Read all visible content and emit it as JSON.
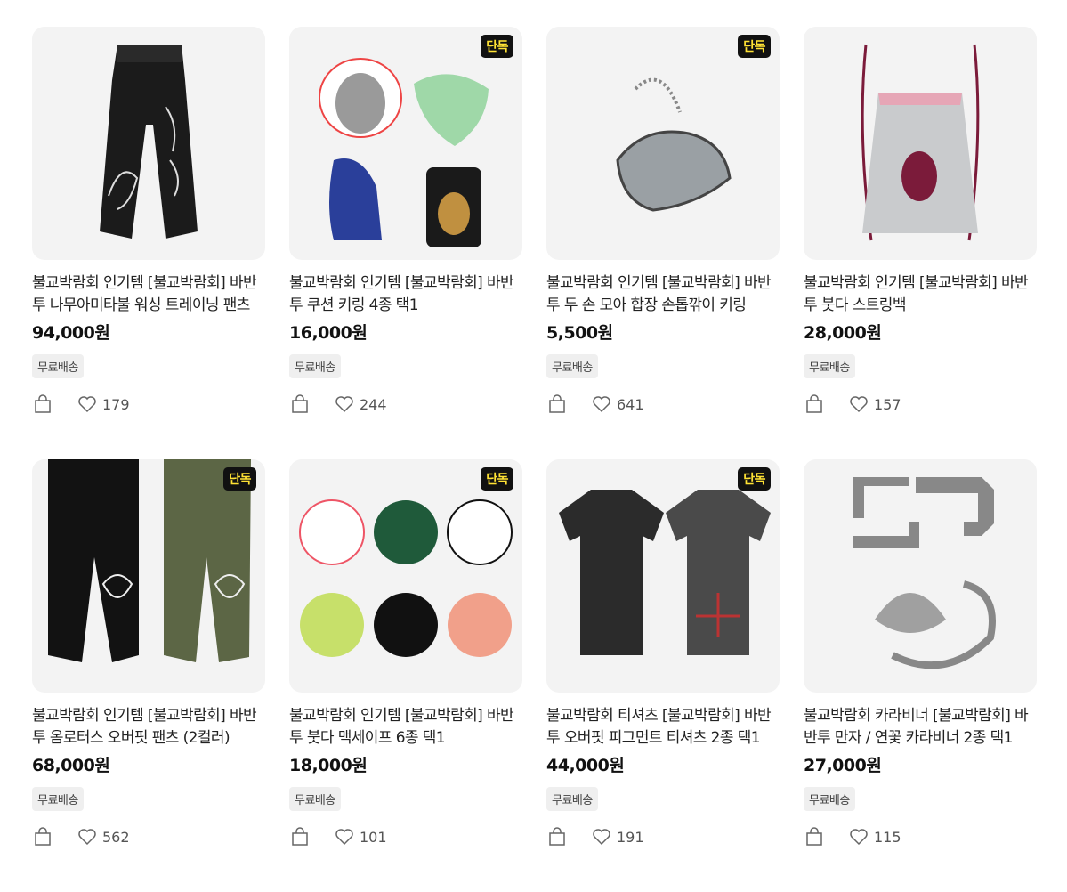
{
  "badge_label": "단독",
  "shipping_label": "무료배송",
  "products": [
    {
      "title": "불교박람회 인기템 [불교박람회] 바반투 나무아미타불 워싱 트레이닝 팬츠",
      "price": "94,000원",
      "likes": "179",
      "exclusive": false,
      "image": "black-pants"
    },
    {
      "title": "불교박람회 인기템 [불교박람회] 바반투 쿠션 키링 4종 택1",
      "price": "16,000원",
      "likes": "244",
      "exclusive": true,
      "image": "cushion-keyrings"
    },
    {
      "title": "불교박람회 인기템 [불교박람회] 바반투 두 손 모아 합장 손톱깎이 키링",
      "price": "5,500원",
      "likes": "641",
      "exclusive": true,
      "image": "nail-clipper"
    },
    {
      "title": "불교박람회 인기템 [불교박람회] 바반투 붓다 스트링백",
      "price": "28,000원",
      "likes": "157",
      "exclusive": false,
      "image": "string-bag"
    },
    {
      "title": "불교박람회 인기템 [불교박람회] 바반투 옴로터스 오버핏 팬츠 (2컬러)",
      "price": "68,000원",
      "likes": "562",
      "exclusive": true,
      "image": "two-pants"
    },
    {
      "title": "불교박람회 인기템 [불교박람회] 바반투 붓다 맥세이프 6종 택1",
      "price": "18,000원",
      "likes": "101",
      "exclusive": true,
      "image": "magsafe"
    },
    {
      "title": "불교박람회 티셔츠 [불교박람회] 바반투 오버핏 피그먼트 티셔츠 2종 택1",
      "price": "44,000원",
      "likes": "191",
      "exclusive": true,
      "image": "tshirts"
    },
    {
      "title": "불교박람회 카라비너 [불교박람회] 바반투 만자 / 연꽃 카라비너 2종 택1",
      "price": "27,000원",
      "likes": "115",
      "exclusive": false,
      "image": "carabiner"
    }
  ]
}
